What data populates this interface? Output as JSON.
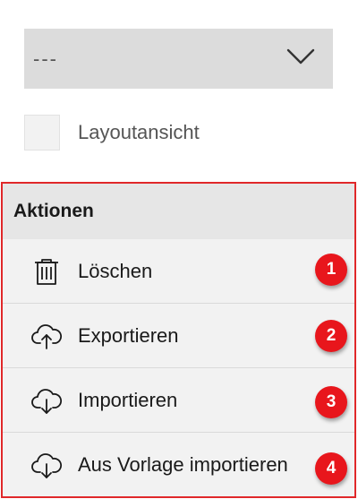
{
  "dropdown": {
    "value": "---",
    "chevron_icon": "chevron-down-icon"
  },
  "layout_toggle": {
    "label": "Layoutansicht",
    "checked": false
  },
  "actions_panel": {
    "title": "Aktionen",
    "highlight_color": "#e0282a",
    "items": [
      {
        "label": "Löschen",
        "icon": "trash-icon",
        "badge": "1"
      },
      {
        "label": "Exportieren",
        "icon": "cloud-upload-icon",
        "badge": "2"
      },
      {
        "label": "Importieren",
        "icon": "cloud-download-icon",
        "badge": "3"
      },
      {
        "label": "Aus Vorlage importieren",
        "icon": "cloud-download-icon",
        "badge": "4"
      }
    ]
  },
  "badge_color": "#e8161c"
}
